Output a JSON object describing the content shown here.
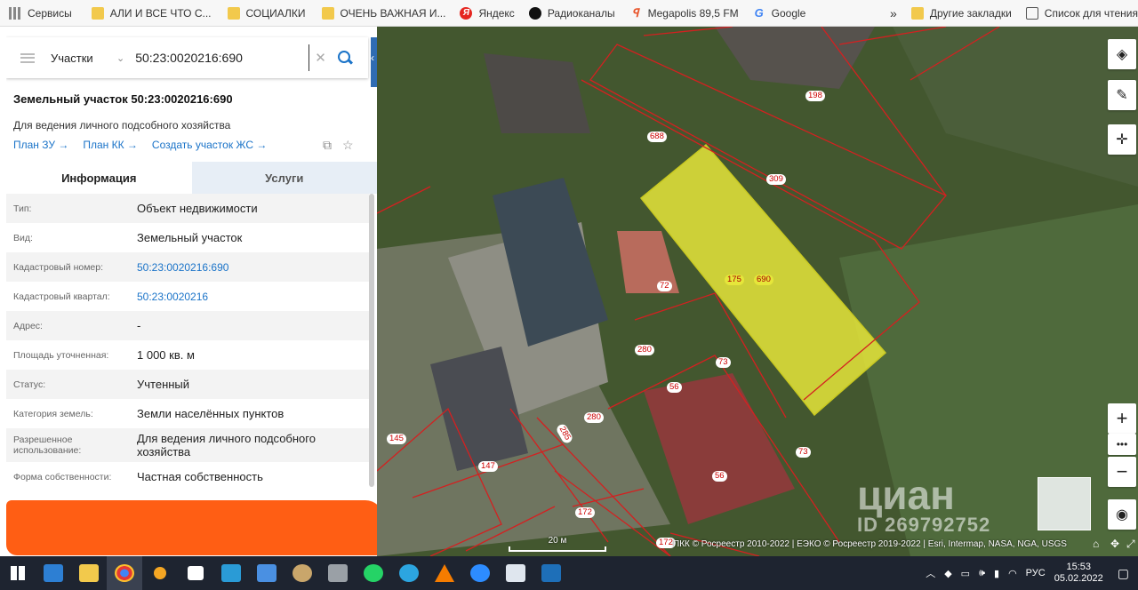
{
  "bookmarks": {
    "items": [
      "Сервисы",
      "АЛИ И ВСЕ ЧТО С...",
      "СОЦИАЛКИ",
      "ОЧЕНЬ ВАЖНАЯ И...",
      "Яндекс",
      "Радиоканалы",
      "Megapolis 89,5 FM",
      "Google"
    ],
    "overflow": "»",
    "other": "Другие закладки",
    "reading_list": "Список для чтения"
  },
  "search": {
    "category": "Участки",
    "query": "50:23:0020216:690"
  },
  "parcel": {
    "title": "Земельный участок 50:23:0020216:690",
    "purpose": "Для ведения личного подсобного хозяйства",
    "links": [
      "План ЗУ →",
      "План КК →",
      "Создать участок ЖС →"
    ]
  },
  "tabs": [
    "Информация",
    "Услуги"
  ],
  "info_rows": [
    {
      "key": "Тип:",
      "value": "Объект недвижимости"
    },
    {
      "key": "Вид:",
      "value": "Земельный участок"
    },
    {
      "key": "Кадастровый номер:",
      "value": "50:23:0020216:690"
    },
    {
      "key": "Кадастровый квартал:",
      "value": "50:23:0020216"
    },
    {
      "key": "Адрес:",
      "value": "-"
    },
    {
      "key": "Площадь уточненная:",
      "value": "1 000 кв. м"
    },
    {
      "key": "Статус:",
      "value": "Учтенный"
    },
    {
      "key": "Категория земель:",
      "value": "Земли населённых пунктов"
    },
    {
      "key": "Разрешенное использование:",
      "value": "Для ведения личного подсобного хозяйства"
    },
    {
      "key": "Форма собственности:",
      "value": "Частная собственность"
    }
  ],
  "map": {
    "labels": [
      "198",
      "688",
      "309",
      "72",
      "175",
      "690",
      "280",
      "73",
      "56",
      "280",
      "285",
      "145",
      "147",
      "56",
      "73",
      "172",
      "172"
    ],
    "scale": "20 м",
    "attribution": "ПКК © Росреестр 2010-2022 | ЕЭКО © Росреестр 2019-2022 | Esri, Intermap, NASA, NGA, USGS",
    "watermark": "циан",
    "watermark_id": "ID 269792752"
  },
  "taskbar": {
    "lang": "РУС",
    "time": "15:53",
    "date": "05.02.2022"
  }
}
